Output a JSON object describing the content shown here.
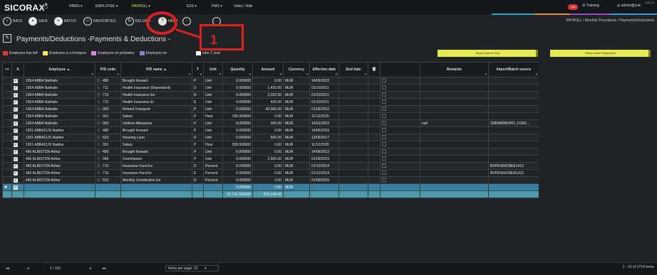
{
  "header": {
    "logo": "SICORAX",
    "logo_mark": "®",
    "version": "v15.1.0",
    "nav": [
      {
        "label": "HRMS ▾"
      },
      {
        "label": "EMPLOYEE ▾"
      },
      {
        "label": "PAYROLL ▾"
      },
      {
        "label": "ESS ▾"
      },
      {
        "label": "PMS ▾"
      },
      {
        "label": "Video / Wiki"
      }
    ],
    "notif_count": "106",
    "training": "Training",
    "user": "admin@ynic"
  },
  "colors": {
    "accent_yellow": "#e3eb4f",
    "active_nav": "#e1e84a",
    "annotation": "#e02020",
    "total_row": "#4b9aaa"
  },
  "toolbar": {
    "back": "BACK",
    "save": "SAVE",
    "batch": "BATCH",
    "favourites": "FAVOURITES",
    "reload": "RELOAD",
    "help": "HELP"
  },
  "breadcrumb": {
    "part1": "PAYROLL",
    "sep1": "/",
    "part2": "Monthly Procedures",
    "sep2": "/",
    "part3": "Payments/Deductions"
  },
  "page": {
    "title": "Payments/Deductions -Payments & Deductions -"
  },
  "legend": [
    {
      "label": "Employee has left",
      "color": "#e53935"
    },
    {
      "label": "Employee is a foreigner",
      "color": "#f2ee4a"
    },
    {
      "label": "Employee on probation",
      "color": "#e57fd8"
    },
    {
      "label": "Employee on",
      "color": "#8e7cc3"
    },
    {
      "label": "nder 1 year",
      "color": "#ffffff"
    }
  ],
  "buttons": {
    "show_current": "Show Current Only",
    "show_active": "Show Active Employees"
  },
  "annotation": {
    "number": "1"
  },
  "table": {
    "headers": [
      "•••",
      "A",
      "Employee ▲",
      "P/D code",
      "P/D name ▲",
      "T",
      "Unit",
      "Quantity",
      "Amount",
      "Currency",
      "Effective date",
      "End date",
      "🗑",
      "",
      "Remarks",
      "Import/Batch source"
    ],
    "rows": [
      [
        "1054 ABBA Nathalie",
        "480",
        "Brought forward",
        "P",
        "Unit",
        "0.000000",
        "0.00",
        "MUR",
        "14/06/2023",
        "",
        "",
        ""
      ],
      [
        "1054 ABBA Nathalie",
        "711",
        "Health Insurance (Dependent)",
        "D",
        "Unit",
        "0.000000",
        "1,420.00",
        "MUR",
        "01/10/2011",
        "",
        "",
        ""
      ],
      [
        "1054 ABBA Nathalie",
        "710",
        "Health Insurance Ee",
        "D",
        "Unit",
        "0.000000",
        "2,022.50",
        "MUR",
        "01/10/2011",
        "",
        "",
        ""
      ],
      [
        "1054 ABBA Nathalie",
        "712",
        "Health Insurance Er",
        "E",
        "Unit",
        "0.000000",
        "426.50",
        "MUR",
        "01/10/2011",
        "",
        "",
        ""
      ],
      [
        "1054 ABBA Nathalie",
        "060",
        "Refund Transport",
        "P",
        "Unit",
        "0.000000",
        "40,000.00",
        "MUR",
        "01/06/2012",
        "",
        "",
        ""
      ],
      [
        "1054 ABBA Nathalie",
        "001",
        "Salary",
        "P",
        "Hour",
        "195.000000",
        "0.00",
        "MUR",
        "11/12/2020",
        "",
        "",
        ""
      ],
      [
        "1054 ABBA Nathalie",
        "093",
        "Uniform Allowance",
        "P",
        "Unit",
        "0.000000",
        "300.00",
        "MUR",
        "14/01/2023",
        "",
        "null",
        "3285983859PD_FOR2..."
      ],
      [
        "1201 ABBACUS Nadine",
        "480",
        "Brought forward",
        "P",
        "Unit",
        "0.000000",
        "0.00",
        "MUR",
        "14/06/2023",
        "",
        "",
        ""
      ],
      [
        "1201 ABBACUS Nadine",
        "603",
        "Housing Loan",
        "D",
        "Unit",
        "0.000000",
        "500.00",
        "MUR",
        "13/06/2017",
        "",
        "",
        ""
      ],
      [
        "1201 ABBACUS Nadine",
        "001",
        "Salary",
        "P",
        "Hour",
        "208.000000",
        "0.00",
        "MUR",
        "11/12/2020",
        "",
        "",
        ""
      ],
      [
        "465 ALBISTON Arthur",
        "480",
        "Brought forward",
        "P",
        "Unit",
        "0.000000",
        "0.00",
        "MUR",
        "14/06/2023",
        "",
        "",
        ""
      ],
      [
        "465 ALBISTON Arthur",
        "096",
        "Commission",
        "P",
        "Unit",
        "0.000000",
        "2,500.00",
        "MUR",
        "01/06/2023",
        "",
        "",
        ""
      ],
      [
        "465 ALBISTON Arthur",
        "715",
        "Insurance Fund Ee",
        "D",
        "Percent",
        "0.040000",
        "0.00",
        "MUR",
        "01/12/2014",
        "",
        "",
        "BVPENSIONEE1412"
      ],
      [
        "465 ALBISTON Arthur",
        "716",
        "Insurance Fund Er",
        "E",
        "Percent",
        "0.000000",
        "0.00",
        "MUR",
        "01/12/2014",
        "",
        "",
        "BVPENSIONER1412"
      ],
      [
        "465 ALBISTON Arthur",
        "522",
        "Monthly Contribution Ee",
        "D",
        "Percent",
        "0.000000",
        "3.00",
        "MUR",
        "01/09/2015",
        "",
        "",
        ""
      ]
    ],
    "new_row": {
      "quantity": "0.000000",
      "amount": "0.00",
      "currency": "MUR"
    },
    "totals": {
      "quantity": "37,741.520000",
      "amount": "873,145.00"
    }
  },
  "pager": {
    "first": "◂◂",
    "prev": "◂",
    "page": "1 / 115",
    "next": "▸",
    "last": "▸▸",
    "per_page": "Items per page: 15",
    "per_page_caret": "▾",
    "summary": "1 - 15 of 1714 items"
  }
}
